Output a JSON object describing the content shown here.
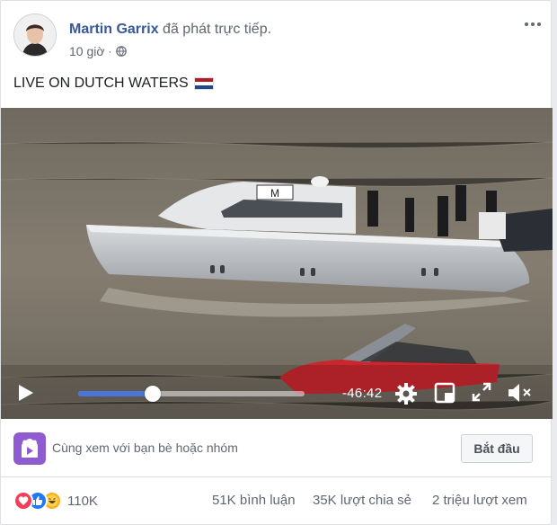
{
  "post": {
    "author": "Martin Garrix",
    "action": "đã phát trực tiếp.",
    "time": "10 giờ",
    "text": "LIVE ON DUTCH WATERS",
    "flag_emoji": "netherlands-flag"
  },
  "video": {
    "remaining_time": "-46:42",
    "progress_fraction": 0.33,
    "boat_logo": "M",
    "icons": [
      "play-icon",
      "settings-gear-icon",
      "watch-layout-icon",
      "fullscreen-icon",
      "volume-muted-icon"
    ]
  },
  "watch_party": {
    "text": "Cùng xem với bạn bè hoặc nhóm",
    "button": "Bắt đầu"
  },
  "stats": {
    "reactions_count": "110K",
    "reaction_icons": [
      "love",
      "like",
      "haha"
    ],
    "comments": "51K bình luận",
    "shares": "35K lượt chia sẻ",
    "views": "2 triệu lượt xem"
  },
  "colors": {
    "link": "#385898",
    "progress": "#4b76d8",
    "watch_icon": "#8f5bd1",
    "like": "#2078f4",
    "love": "#f33e58"
  }
}
